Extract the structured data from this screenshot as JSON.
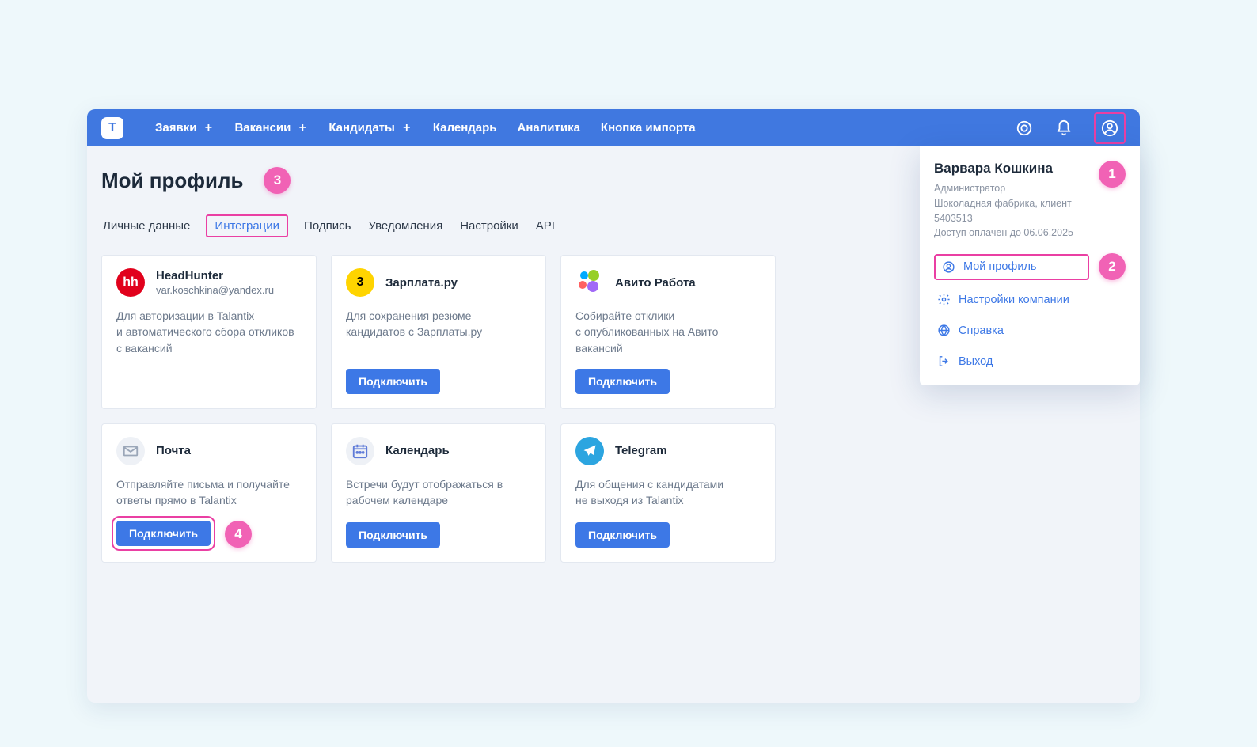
{
  "colors": {
    "primary": "#4078e0",
    "accent_pink": "#ea3fa3",
    "badge_pink": "#f162b5",
    "page_bg": "#eef8fb",
    "panel_bg": "#f1f4f9"
  },
  "topbar": {
    "logo_letter": "T",
    "items": [
      {
        "label": "Заявки",
        "has_plus": true
      },
      {
        "label": "Вакансии",
        "has_plus": true
      },
      {
        "label": "Кандидаты",
        "has_plus": true
      },
      {
        "label": "Календарь",
        "has_plus": false
      },
      {
        "label": "Аналитика",
        "has_plus": false
      },
      {
        "label": "Кнопка импорта",
        "has_plus": false
      }
    ],
    "icons": {
      "help": "help-circle-icon",
      "bell": "bell-icon",
      "profile": "profile-icon"
    }
  },
  "page": {
    "title": "Мой профиль"
  },
  "tabs": [
    {
      "label": "Личные данные",
      "active": false
    },
    {
      "label": "Интеграции",
      "active": true
    },
    {
      "label": "Подпись",
      "active": false
    },
    {
      "label": "Уведомления",
      "active": false
    },
    {
      "label": "Настройки",
      "active": false
    },
    {
      "label": "API",
      "active": false
    }
  ],
  "badges": {
    "profile_icon": "1",
    "popover_my_profile": "2",
    "page_title": "3",
    "mail_connect": "4"
  },
  "cards": [
    {
      "icon": "hh",
      "title": "HeadHunter",
      "subtitle": "var.koschkina@yandex.ru",
      "desc": "Для авторизации в Talantix\nи автоматического сбора откликов\nс вакансий",
      "button": null
    },
    {
      "icon": "zp",
      "title": "Зарплата.ру",
      "subtitle": "",
      "desc": "Для сохранения резюме\nкандидатов с Зарплаты.ру",
      "button": "Подключить"
    },
    {
      "icon": "avito",
      "title": "Авито Работа",
      "subtitle": "",
      "desc": "Собирайте отклики\nс опубликованных на Авито\nвакансий",
      "button": "Подключить"
    },
    {
      "icon": "mail",
      "title": "Почта",
      "subtitle": "",
      "desc": "Отправляйте письма и получайте\nответы прямо в Talantix",
      "button": "Подключить",
      "button_highlight": true
    },
    {
      "icon": "cal",
      "title": "Календарь",
      "subtitle": "",
      "desc": "Встречи будут отображаться в\nрабочем календаре",
      "button": "Подключить"
    },
    {
      "icon": "tg",
      "title": "Telegram",
      "subtitle": "",
      "desc": "Для общения с кандидатами\nне выходя из Talantix",
      "button": "Подключить"
    }
  ],
  "profile_popover": {
    "name": "Варвара Кошкина",
    "role": "Администратор",
    "company": "Шоколадная фабрика, клиент 5403513",
    "access": "Доступ оплачен до 06.06.2025",
    "links": [
      {
        "label": "Мой профиль",
        "icon": "user-circle-icon",
        "highlight": true
      },
      {
        "label": "Настройки компании",
        "icon": "gear-icon",
        "highlight": false
      },
      {
        "label": "Справка",
        "icon": "globe-icon",
        "highlight": false
      },
      {
        "label": "Выход",
        "icon": "logout-icon",
        "highlight": false
      }
    ]
  }
}
